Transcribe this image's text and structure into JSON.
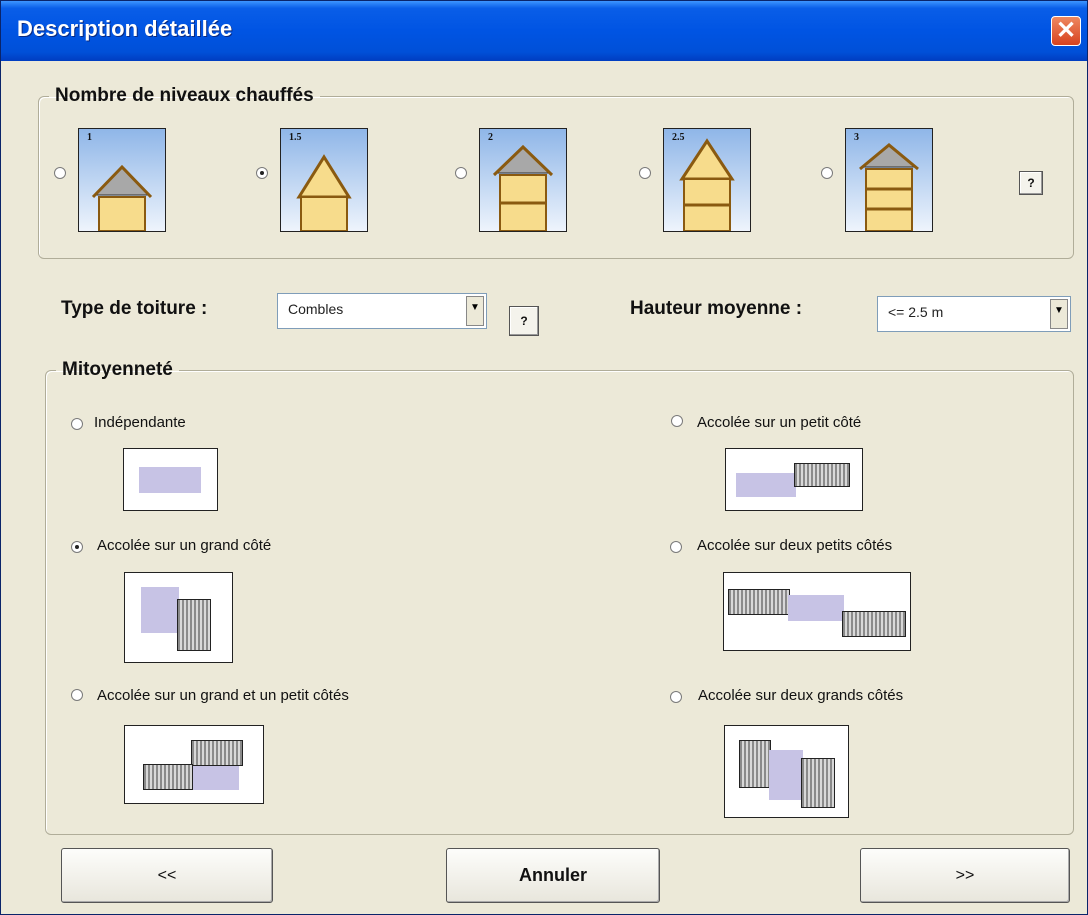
{
  "window": {
    "title": "Description détaillée",
    "close_glyph": "✕"
  },
  "levels": {
    "legend": "Nombre de niveaux chauffés",
    "options": [
      {
        "label": "1",
        "checked": false
      },
      {
        "label": "1.5",
        "checked": true
      },
      {
        "label": "2",
        "checked": false
      },
      {
        "label": "2.5",
        "checked": false
      },
      {
        "label": "3",
        "checked": false
      }
    ],
    "help_label": "?"
  },
  "roof": {
    "label": "Type de toiture :",
    "value": "Combles",
    "help_label": "?"
  },
  "height": {
    "label": "Hauteur moyenne :",
    "value": "<= 2.5 m"
  },
  "mitoyennete": {
    "legend": "Mitoyenneté",
    "options": [
      {
        "label": "Indépendante",
        "checked": false
      },
      {
        "label": "Accolée sur un petit côté",
        "checked": false
      },
      {
        "label": "Accolée sur un grand côté",
        "checked": true
      },
      {
        "label": "Accolée sur deux petits côtés",
        "checked": false
      },
      {
        "label": "Accolée sur un grand et un petit côtés",
        "checked": false
      },
      {
        "label": "Accolée sur deux grands côtés",
        "checked": false
      }
    ]
  },
  "footer": {
    "prev_label": "<<",
    "cancel_label": "Annuler",
    "next_label": ">>"
  },
  "colors": {
    "titlebar": "#0054e3",
    "house_wall": "#f7dc8c",
    "roof": "#a8a8a8",
    "neighbor_violet": "#c7c3e5"
  }
}
